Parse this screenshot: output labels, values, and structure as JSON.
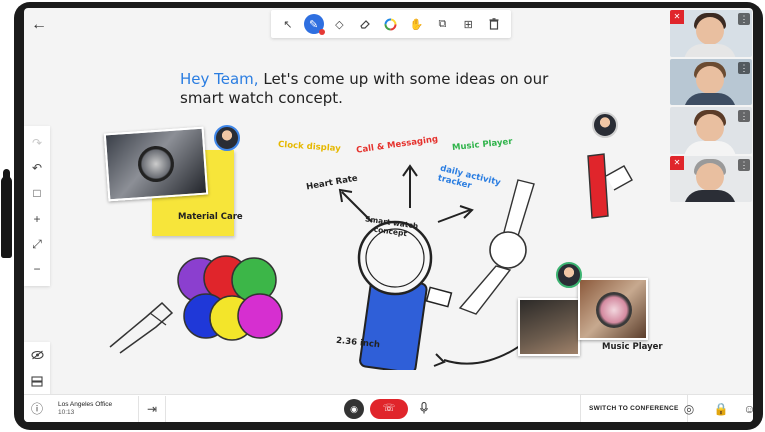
{
  "toolbar": {
    "icons": [
      "cursor-icon",
      "pen-icon",
      "shape-icon",
      "eraser-icon",
      "color-wheel-icon",
      "hand-icon",
      "copy-icon",
      "add-page-icon",
      "trash-icon"
    ]
  },
  "board": {
    "headline_part1": "Hey Team,",
    "headline_part2": " Let's come up with some ideas on our smart watch concept.",
    "center_label": "Smart watch concept",
    "sticky_label": "Material Care",
    "notes": {
      "clock": "Clock display",
      "call": "Call & Messaging",
      "music_top": "Music Player",
      "heart": "Heart Rate",
      "activity": "daily activity tracker",
      "size": "2.36 inch",
      "music_bottom": "Music Player"
    },
    "colors": {
      "accent_blue": "#2a7de1",
      "note_yellow": "#e6b800",
      "note_red": "#e5322d",
      "note_green": "#2fb34a"
    }
  },
  "participants": [
    {
      "muted": true,
      "bg": "#d7dfe6",
      "hair": "#3b2a22",
      "shirt": "#e6e6e6"
    },
    {
      "muted": false,
      "bg": "#b8c7d3",
      "hair": "#6b4b31",
      "shirt": "#3d4d62"
    },
    {
      "muted": false,
      "bg": "#dfe3e7",
      "hair": "#5a3b28",
      "shirt": "#f4f4f4"
    },
    {
      "muted": true,
      "bg": "#e6e8ea",
      "hair": "#9a9a9a",
      "shirt": "#2b2e36"
    }
  ],
  "bottom": {
    "office_name": "Los Angeles Office",
    "office_time": "10:13",
    "switch_label": "SWITCH TO CONFERENCE"
  }
}
